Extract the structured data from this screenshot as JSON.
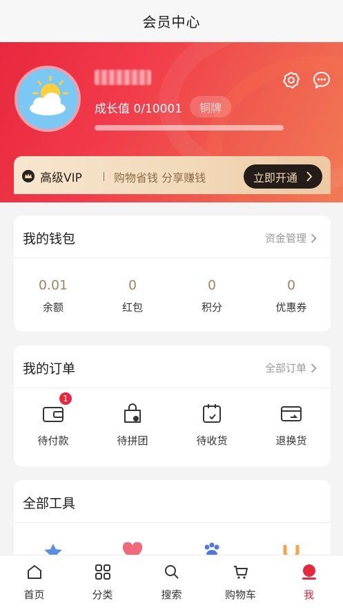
{
  "header": {
    "title": "会员中心"
  },
  "profile": {
    "username": "nickname",
    "growth_text": "成长值 0/10001",
    "growth_value": 0,
    "growth_max": 10001,
    "level": "铜牌",
    "avatar_icon": "sun-cloud-avatar-icon"
  },
  "vip": {
    "title": "高级VIP",
    "slogan": "购物省钱 分享赚钱",
    "button": "立即开通"
  },
  "wallet": {
    "title": "我的钱包",
    "link": "资金管理",
    "items": [
      {
        "value": "0.01",
        "label": "余额"
      },
      {
        "value": "0",
        "label": "红包"
      },
      {
        "value": "0",
        "label": "积分"
      },
      {
        "value": "0",
        "label": "优惠券"
      }
    ]
  },
  "orders": {
    "title": "我的订单",
    "link": "全部订单",
    "items": [
      {
        "label": "待付款",
        "icon": "wallet-icon",
        "badge": "1"
      },
      {
        "label": "待拼团",
        "icon": "bag-icon"
      },
      {
        "label": "待收货",
        "icon": "parcel-icon"
      },
      {
        "label": "退换货",
        "icon": "return-icon"
      }
    ]
  },
  "tools": {
    "title": "全部工具",
    "icons": [
      "star-icon",
      "heart-icon",
      "paw-icon",
      "magnet-icon"
    ]
  },
  "tabbar": {
    "items": [
      {
        "label": "首页",
        "icon": "home-icon"
      },
      {
        "label": "分类",
        "icon": "grid-icon"
      },
      {
        "label": "搜索",
        "icon": "search-icon"
      },
      {
        "label": "购物车",
        "icon": "cart-icon"
      },
      {
        "label": "我",
        "icon": "profile-icon",
        "active": true
      }
    ]
  },
  "colors": {
    "accent": "#e8283e",
    "gold": "#a38462",
    "vip_dark": "#231c18"
  }
}
